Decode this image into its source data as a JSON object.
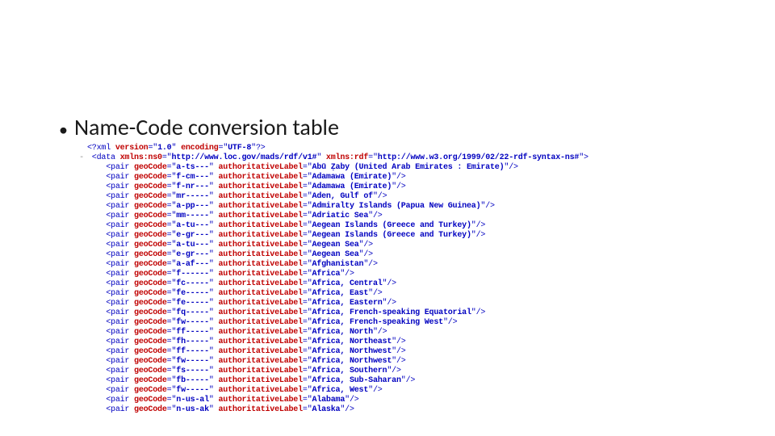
{
  "title_bullet": "•",
  "title_text": "Name-Code conversion table",
  "xml": {
    "decl": {
      "version": "1.0",
      "encoding": "UTF-8"
    },
    "root": {
      "name": "data",
      "ns0_attr": "xmlns:ns0",
      "ns0_val": "http://www.loc.gov/mads/rdf/v1#",
      "rdf_attr": "xmlns:rdf",
      "rdf_val": "http://www.w3.org/1999/02/22-rdf-syntax-ns#"
    },
    "pair_elem": "pair",
    "attr_geo": "geoCode",
    "attr_lbl": "authoritativeLabel",
    "rows": [
      {
        "code": "a-ts---",
        "label": "Abū Ẓaby (United Arab Emirates : Emirate)"
      },
      {
        "code": "f-cm---",
        "label": "Adamawa (Emirate)"
      },
      {
        "code": "f-nr---",
        "label": "Adamawa (Emirate)"
      },
      {
        "code": "mr-----",
        "label": "Aden, Gulf of"
      },
      {
        "code": "a-pp---",
        "label": "Admiralty Islands (Papua New Guinea)"
      },
      {
        "code": "mm-----",
        "label": "Adriatic Sea"
      },
      {
        "code": "a-tu---",
        "label": "Aegean Islands (Greece and Turkey)"
      },
      {
        "code": "e-gr---",
        "label": "Aegean Islands (Greece and Turkey)"
      },
      {
        "code": "a-tu---",
        "label": "Aegean Sea"
      },
      {
        "code": "e-gr---",
        "label": "Aegean Sea"
      },
      {
        "code": "a-af---",
        "label": "Afghanistan"
      },
      {
        "code": "f------",
        "label": "Africa"
      },
      {
        "code": "fc-----",
        "label": "Africa, Central"
      },
      {
        "code": "fe-----",
        "label": "Africa, East"
      },
      {
        "code": "fe-----",
        "label": "Africa, Eastern"
      },
      {
        "code": "fq-----",
        "label": "Africa, French-speaking Equatorial"
      },
      {
        "code": "fw-----",
        "label": "Africa, French-speaking West"
      },
      {
        "code": "ff-----",
        "label": "Africa, North"
      },
      {
        "code": "fh-----",
        "label": "Africa, Northeast"
      },
      {
        "code": "ff-----",
        "label": "Africa, Northwest"
      },
      {
        "code": "fw-----",
        "label": "Africa, Northwest"
      },
      {
        "code": "fs-----",
        "label": "Africa, Southern"
      },
      {
        "code": "fb-----",
        "label": "Africa, Sub-Saharan"
      },
      {
        "code": "fw-----",
        "label": "Africa, West"
      },
      {
        "code": "n-us-al",
        "label": "Alabama"
      },
      {
        "code": "n-us-ak",
        "label": "Alaska"
      }
    ]
  }
}
